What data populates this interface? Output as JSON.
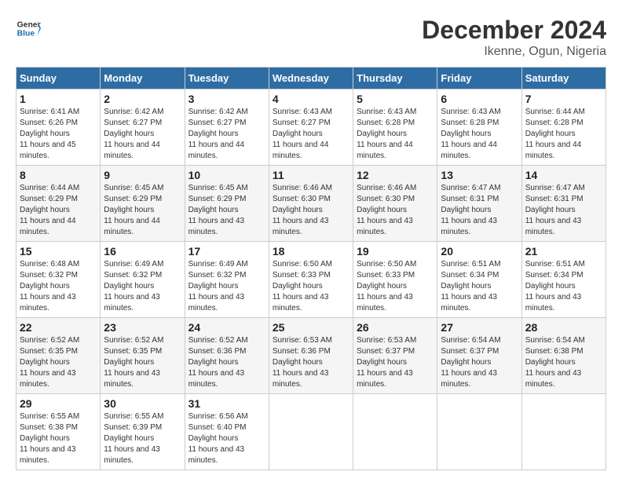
{
  "header": {
    "logo_general": "General",
    "logo_blue": "Blue",
    "month": "December 2024",
    "location": "Ikenne, Ogun, Nigeria"
  },
  "weekdays": [
    "Sunday",
    "Monday",
    "Tuesday",
    "Wednesday",
    "Thursday",
    "Friday",
    "Saturday"
  ],
  "weeks": [
    [
      {
        "day": "1",
        "sunrise": "6:41 AM",
        "sunset": "6:26 PM",
        "daylight": "11 hours and 45 minutes."
      },
      {
        "day": "2",
        "sunrise": "6:42 AM",
        "sunset": "6:27 PM",
        "daylight": "11 hours and 44 minutes."
      },
      {
        "day": "3",
        "sunrise": "6:42 AM",
        "sunset": "6:27 PM",
        "daylight": "11 hours and 44 minutes."
      },
      {
        "day": "4",
        "sunrise": "6:43 AM",
        "sunset": "6:27 PM",
        "daylight": "11 hours and 44 minutes."
      },
      {
        "day": "5",
        "sunrise": "6:43 AM",
        "sunset": "6:28 PM",
        "daylight": "11 hours and 44 minutes."
      },
      {
        "day": "6",
        "sunrise": "6:43 AM",
        "sunset": "6:28 PM",
        "daylight": "11 hours and 44 minutes."
      },
      {
        "day": "7",
        "sunrise": "6:44 AM",
        "sunset": "6:28 PM",
        "daylight": "11 hours and 44 minutes."
      }
    ],
    [
      {
        "day": "8",
        "sunrise": "6:44 AM",
        "sunset": "6:29 PM",
        "daylight": "11 hours and 44 minutes."
      },
      {
        "day": "9",
        "sunrise": "6:45 AM",
        "sunset": "6:29 PM",
        "daylight": "11 hours and 44 minutes."
      },
      {
        "day": "10",
        "sunrise": "6:45 AM",
        "sunset": "6:29 PM",
        "daylight": "11 hours and 43 minutes."
      },
      {
        "day": "11",
        "sunrise": "6:46 AM",
        "sunset": "6:30 PM",
        "daylight": "11 hours and 43 minutes."
      },
      {
        "day": "12",
        "sunrise": "6:46 AM",
        "sunset": "6:30 PM",
        "daylight": "11 hours and 43 minutes."
      },
      {
        "day": "13",
        "sunrise": "6:47 AM",
        "sunset": "6:31 PM",
        "daylight": "11 hours and 43 minutes."
      },
      {
        "day": "14",
        "sunrise": "6:47 AM",
        "sunset": "6:31 PM",
        "daylight": "11 hours and 43 minutes."
      }
    ],
    [
      {
        "day": "15",
        "sunrise": "6:48 AM",
        "sunset": "6:32 PM",
        "daylight": "11 hours and 43 minutes."
      },
      {
        "day": "16",
        "sunrise": "6:49 AM",
        "sunset": "6:32 PM",
        "daylight": "11 hours and 43 minutes."
      },
      {
        "day": "17",
        "sunrise": "6:49 AM",
        "sunset": "6:32 PM",
        "daylight": "11 hours and 43 minutes."
      },
      {
        "day": "18",
        "sunrise": "6:50 AM",
        "sunset": "6:33 PM",
        "daylight": "11 hours and 43 minutes."
      },
      {
        "day": "19",
        "sunrise": "6:50 AM",
        "sunset": "6:33 PM",
        "daylight": "11 hours and 43 minutes."
      },
      {
        "day": "20",
        "sunrise": "6:51 AM",
        "sunset": "6:34 PM",
        "daylight": "11 hours and 43 minutes."
      },
      {
        "day": "21",
        "sunrise": "6:51 AM",
        "sunset": "6:34 PM",
        "daylight": "11 hours and 43 minutes."
      }
    ],
    [
      {
        "day": "22",
        "sunrise": "6:52 AM",
        "sunset": "6:35 PM",
        "daylight": "11 hours and 43 minutes."
      },
      {
        "day": "23",
        "sunrise": "6:52 AM",
        "sunset": "6:35 PM",
        "daylight": "11 hours and 43 minutes."
      },
      {
        "day": "24",
        "sunrise": "6:52 AM",
        "sunset": "6:36 PM",
        "daylight": "11 hours and 43 minutes."
      },
      {
        "day": "25",
        "sunrise": "6:53 AM",
        "sunset": "6:36 PM",
        "daylight": "11 hours and 43 minutes."
      },
      {
        "day": "26",
        "sunrise": "6:53 AM",
        "sunset": "6:37 PM",
        "daylight": "11 hours and 43 minutes."
      },
      {
        "day": "27",
        "sunrise": "6:54 AM",
        "sunset": "6:37 PM",
        "daylight": "11 hours and 43 minutes."
      },
      {
        "day": "28",
        "sunrise": "6:54 AM",
        "sunset": "6:38 PM",
        "daylight": "11 hours and 43 minutes."
      }
    ],
    [
      {
        "day": "29",
        "sunrise": "6:55 AM",
        "sunset": "6:38 PM",
        "daylight": "11 hours and 43 minutes."
      },
      {
        "day": "30",
        "sunrise": "6:55 AM",
        "sunset": "6:39 PM",
        "daylight": "11 hours and 43 minutes."
      },
      {
        "day": "31",
        "sunrise": "6:56 AM",
        "sunset": "6:40 PM",
        "daylight": "11 hours and 43 minutes."
      },
      null,
      null,
      null,
      null
    ]
  ],
  "labels": {
    "sunrise": "Sunrise:",
    "sunset": "Sunset:",
    "daylight": "Daylight hours"
  }
}
